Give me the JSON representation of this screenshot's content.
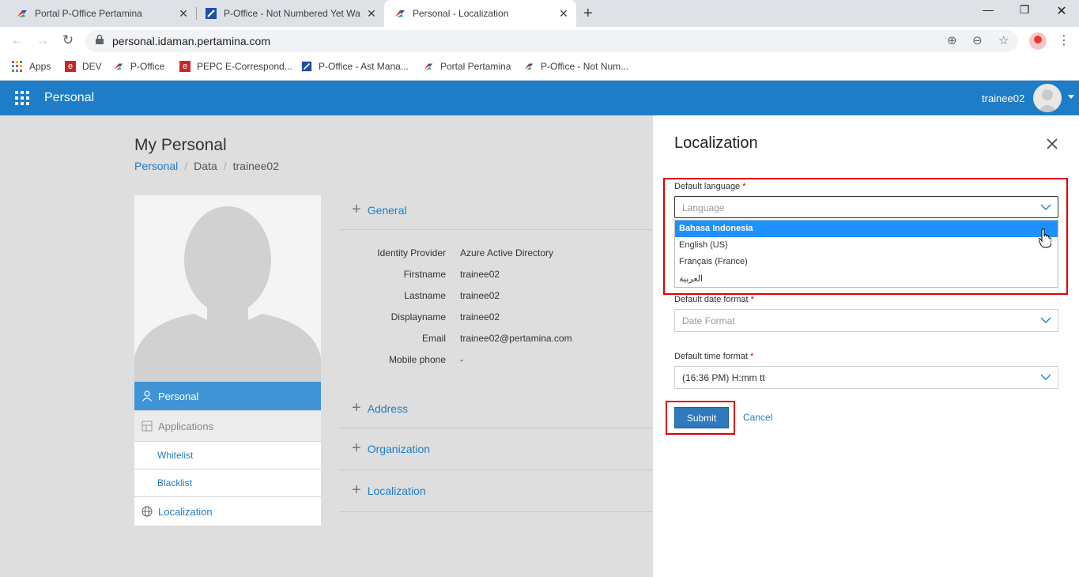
{
  "browser": {
    "tabs": [
      {
        "title": "Portal P-Office Pertamina"
      },
      {
        "title": "P-Office - Not Numbered Yet Wa"
      },
      {
        "title": "Personal - Localization"
      }
    ],
    "url": "personal.idaman.pertamina.com",
    "bookmarks": [
      {
        "label": "Apps"
      },
      {
        "label": "DEV"
      },
      {
        "label": "P-Office"
      },
      {
        "label": "PEPC E-Correspond..."
      },
      {
        "label": "P-Office - Ast Mana..."
      },
      {
        "label": "Portal Pertamina"
      },
      {
        "label": "P-Office - Not Num..."
      }
    ]
  },
  "header": {
    "app_title": "Personal",
    "username": "trainee02"
  },
  "page": {
    "title": "My Personal",
    "breadcrumb": [
      "Personal",
      "Data",
      "trainee02"
    ]
  },
  "sidenav": {
    "personal": "Personal",
    "applications": "Applications",
    "whitelist": "Whitelist",
    "blacklist": "Blacklist",
    "localization": "Localization"
  },
  "sections": {
    "general": "General",
    "address": "Address",
    "organization": "Organization",
    "localization": "Localization"
  },
  "properties": [
    {
      "key": "Identity Provider",
      "value": "Azure Active Directory"
    },
    {
      "key": "Firstname",
      "value": "trainee02"
    },
    {
      "key": "Lastname",
      "value": "trainee02"
    },
    {
      "key": "Displayname",
      "value": "trainee02"
    },
    {
      "key": "Email",
      "value": "trainee02@pertamina.com"
    },
    {
      "key": "Mobile phone",
      "value": "-"
    }
  ],
  "panel": {
    "title": "Localization",
    "language_label": "Default language",
    "language_placeholder": "Language",
    "language_options": [
      "Bahasa Indonesia",
      "English (US)",
      "Français (France)",
      "العربية"
    ],
    "date_label": "Default date format",
    "date_placeholder": "Date Format",
    "time_label": "Default time format",
    "time_value": "(16:36 PM) H:mm tt",
    "required_mark": "*",
    "submit": "Submit",
    "cancel": "Cancel"
  },
  "colors": {
    "header_bg": "#1e7dc6",
    "highlight_red": "#e30000",
    "selected_option": "#1e90ff"
  }
}
